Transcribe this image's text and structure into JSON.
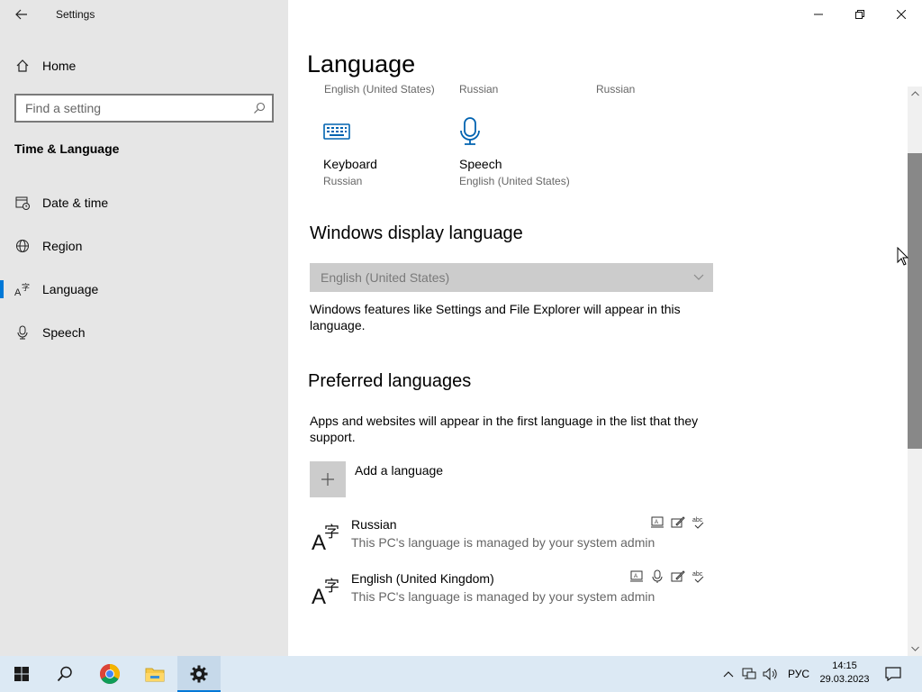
{
  "window": {
    "title": "Settings"
  },
  "nav": {
    "home_label": "Home",
    "search_placeholder": "Find a setting",
    "section_title": "Time & Language",
    "items": [
      {
        "label": "Date & time",
        "icon": "calendar-clock-icon"
      },
      {
        "label": "Region",
        "icon": "globe-icon"
      },
      {
        "label": "Language",
        "icon": "language-icon",
        "active": true
      },
      {
        "label": "Speech",
        "icon": "microphone-icon"
      }
    ]
  },
  "content": {
    "page_title": "Language",
    "top_subtitles": [
      "English (United States)",
      "Russian",
      "Russian"
    ],
    "tiles": [
      {
        "name": "Keyboard",
        "sub": "Russian",
        "icon": "keyboard-icon"
      },
      {
        "name": "Speech",
        "sub": "English (United States)",
        "icon": "microphone-icon"
      }
    ],
    "display_language": {
      "heading": "Windows display language",
      "selected": "English (United States)",
      "description": "Windows features like Settings and File Explorer will appear in this language."
    },
    "preferred": {
      "heading": "Preferred languages",
      "description": "Apps and websites will appear in the first language in the list that they support.",
      "add_label": "Add a language",
      "languages": [
        {
          "name": "Russian",
          "note": "This PC's language is managed by your system admin",
          "features": [
            "display-language-icon",
            "handwriting-icon",
            "spellcheck-icon"
          ]
        },
        {
          "name": "English (United Kingdom)",
          "note": "This PC's language is managed by your system admin",
          "features": [
            "display-language-icon",
            "speech-icon",
            "handwriting-icon",
            "spellcheck-icon"
          ]
        }
      ]
    }
  },
  "taskbar": {
    "lang_indicator": "РУС",
    "time": "14:15",
    "date": "29.03.2023",
    "accent": "#0078d7"
  }
}
